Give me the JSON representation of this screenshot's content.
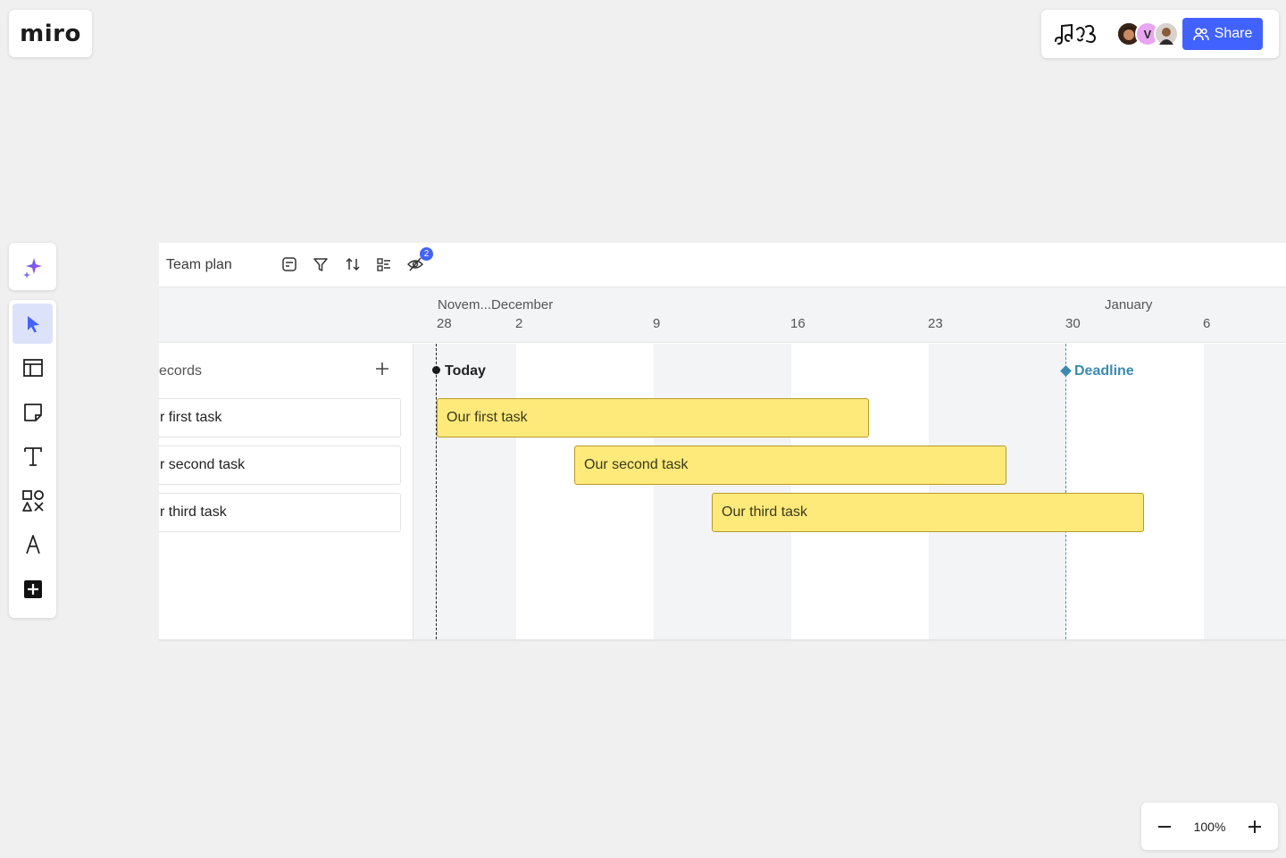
{
  "app": {
    "logo": "miro"
  },
  "topbar": {
    "share_label": "Share",
    "avatar_initial": "V"
  },
  "frame": {
    "title": "Team plan",
    "hidden_count": "2",
    "months": [
      {
        "label": "Novem...December"
      },
      {
        "label": "January"
      }
    ],
    "days": [
      "28",
      "2",
      "9",
      "16",
      "23",
      "30",
      "6"
    ],
    "records_label": "ecords",
    "records": [
      {
        "label": "r first task"
      },
      {
        "label": "r second task"
      },
      {
        "label": "r third task"
      }
    ],
    "today_label": "Today",
    "deadline_label": "Deadline",
    "tasks": [
      {
        "label": "Our first task"
      },
      {
        "label": "Our second task"
      },
      {
        "label": "Our third task"
      }
    ]
  },
  "zoom": {
    "value": "100%"
  },
  "colors": {
    "accent": "#4262ff",
    "task_fill": "#fee97b",
    "deadline": "#3a8ab0"
  }
}
